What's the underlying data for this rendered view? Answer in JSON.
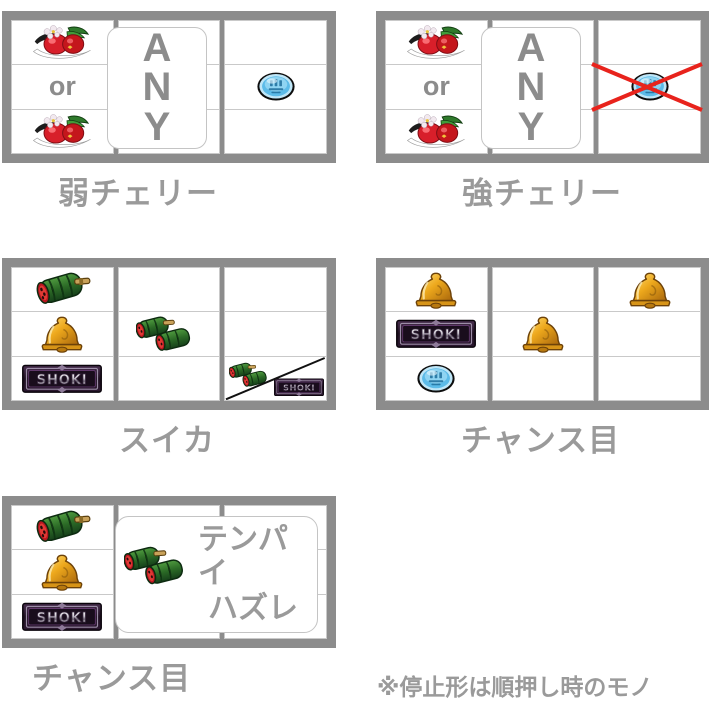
{
  "page": {
    "background": "#ffffff",
    "frame_color": "#8c8c8c",
    "label_color": "#9a9a9a",
    "accent_red": "#e8231c"
  },
  "panels": [
    {
      "id": "weak-cherry",
      "caption": "弱チェリー",
      "overlay": {
        "type": "any",
        "letters": [
          "A",
          "N",
          "Y"
        ]
      },
      "cells": [
        [
          "cherry",
          "",
          ""
        ],
        [
          "or",
          "",
          "replay"
        ],
        [
          "cherry",
          "",
          ""
        ]
      ]
    },
    {
      "id": "strong-cherry",
      "caption": "強チェリー",
      "overlay": {
        "type": "any",
        "letters": [
          "A",
          "N",
          "Y"
        ]
      },
      "cells": [
        [
          "cherry",
          "",
          ""
        ],
        [
          "or",
          "",
          "replay-crossed"
        ],
        [
          "cherry",
          "",
          ""
        ]
      ]
    },
    {
      "id": "watermelon",
      "caption": "スイカ",
      "cells": [
        [
          "watermelon",
          "",
          ""
        ],
        [
          "bell",
          "watermelon-double",
          ""
        ],
        [
          "shoki",
          "",
          "watermelon-shoki-split"
        ]
      ]
    },
    {
      "id": "chance-me-bell",
      "caption": "チャンス目",
      "cells": [
        [
          "bell",
          "",
          "bell"
        ],
        [
          "shoki",
          "bell",
          ""
        ],
        [
          "replay",
          "",
          ""
        ]
      ]
    },
    {
      "id": "chance-me-tenpai",
      "caption": "チャンス目",
      "overlay": {
        "type": "tenpai",
        "line1": "テンパイ",
        "line2": "ハズレ",
        "icon": "watermelon-double"
      },
      "cells": [
        [
          "watermelon",
          "",
          ""
        ],
        [
          "bell",
          "",
          ""
        ],
        [
          "shoki",
          "",
          ""
        ]
      ]
    }
  ],
  "symbols": {
    "cherry": {
      "name": "cherry-symbol",
      "colors": [
        "#d81f2a",
        "#2f7a2c",
        "#ffffff"
      ]
    },
    "replay": {
      "name": "replay-symbol",
      "colors": [
        "#56b6e8",
        "#1a1a1a"
      ]
    },
    "watermelon": {
      "name": "watermelon-symbol",
      "colors": [
        "#2e6b2b",
        "#c4161c",
        "#1c1c1c"
      ]
    },
    "bell": {
      "name": "bell-symbol",
      "colors": [
        "#e8a419",
        "#f5d04a",
        "#8c5a10"
      ]
    },
    "shoki": {
      "name": "shoki-plaque-symbol",
      "text": "SHOKI",
      "colors": [
        "#2a1726",
        "#b8b2bd",
        "#6d3f7a"
      ]
    }
  },
  "footnote": "※停止形は順押し時のモノ",
  "or_label": "or"
}
